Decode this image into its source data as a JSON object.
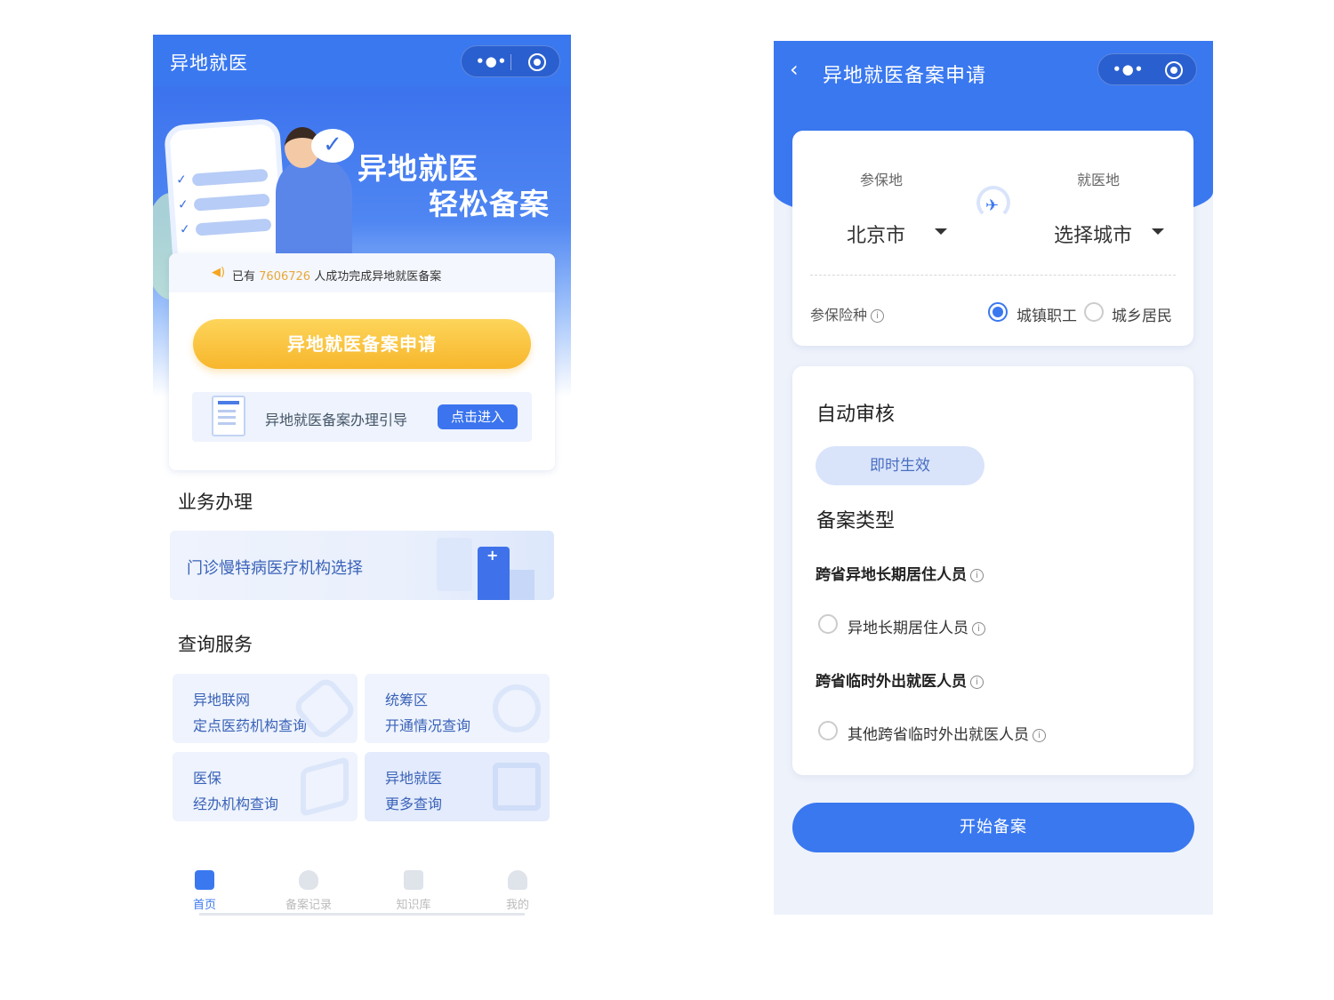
{
  "left": {
    "nav": {
      "title": "异地就医"
    },
    "banner": {
      "slogan_line1": "异地就医",
      "slogan_line2": "轻松备案"
    },
    "notice": {
      "prefix": "已有",
      "count": "7606726",
      "suffix": "人成功完成异地就医备案"
    },
    "apply_button": "异地就医备案申请",
    "guide": {
      "text": "异地就医备案办理引导",
      "button": "点击进入"
    },
    "business": {
      "title": "业务办理",
      "item": "门诊慢特病医疗机构选择"
    },
    "query": {
      "title": "查询服务",
      "cards": [
        {
          "line1": "异地联网",
          "line2": "定点医药机构查询"
        },
        {
          "line1": "统筹区",
          "line2": "开通情况查询"
        },
        {
          "line1": "医保",
          "line2": "经办机构查询"
        },
        {
          "line1": "异地就医",
          "line2": "更多查询"
        }
      ]
    },
    "tabs": [
      {
        "label": "首页",
        "icon": "home-icon",
        "active": true
      },
      {
        "label": "备案记录",
        "icon": "shield-record-icon",
        "active": false
      },
      {
        "label": "知识库",
        "icon": "book-icon",
        "active": false
      },
      {
        "label": "我的",
        "icon": "user-icon",
        "active": false
      }
    ]
  },
  "right": {
    "nav": {
      "back": "‹",
      "title": "异地就医备案申请"
    },
    "insured_place": {
      "label": "参保地",
      "value": "北京市"
    },
    "treatment_place": {
      "label": "就医地",
      "value": "选择城市"
    },
    "insurance_type": {
      "label": "参保险种",
      "options": [
        {
          "label": "城镇职工",
          "selected": true
        },
        {
          "label": "城乡居民",
          "selected": false
        }
      ]
    },
    "audit": {
      "title": "自动审核",
      "badge": "即时生效"
    },
    "record_type": {
      "title": "备案类型",
      "groups": [
        {
          "category": "跨省异地长期居住人员",
          "option": "异地长期居住人员"
        },
        {
          "category": "跨省临时外出就医人员",
          "option": "其他跨省临时外出就医人员"
        }
      ]
    },
    "start_button": "开始备案"
  },
  "colors": {
    "primary": "#3a78f0",
    "accent_yellow": "#f7b62c",
    "light_blue": "#eef3fd"
  }
}
